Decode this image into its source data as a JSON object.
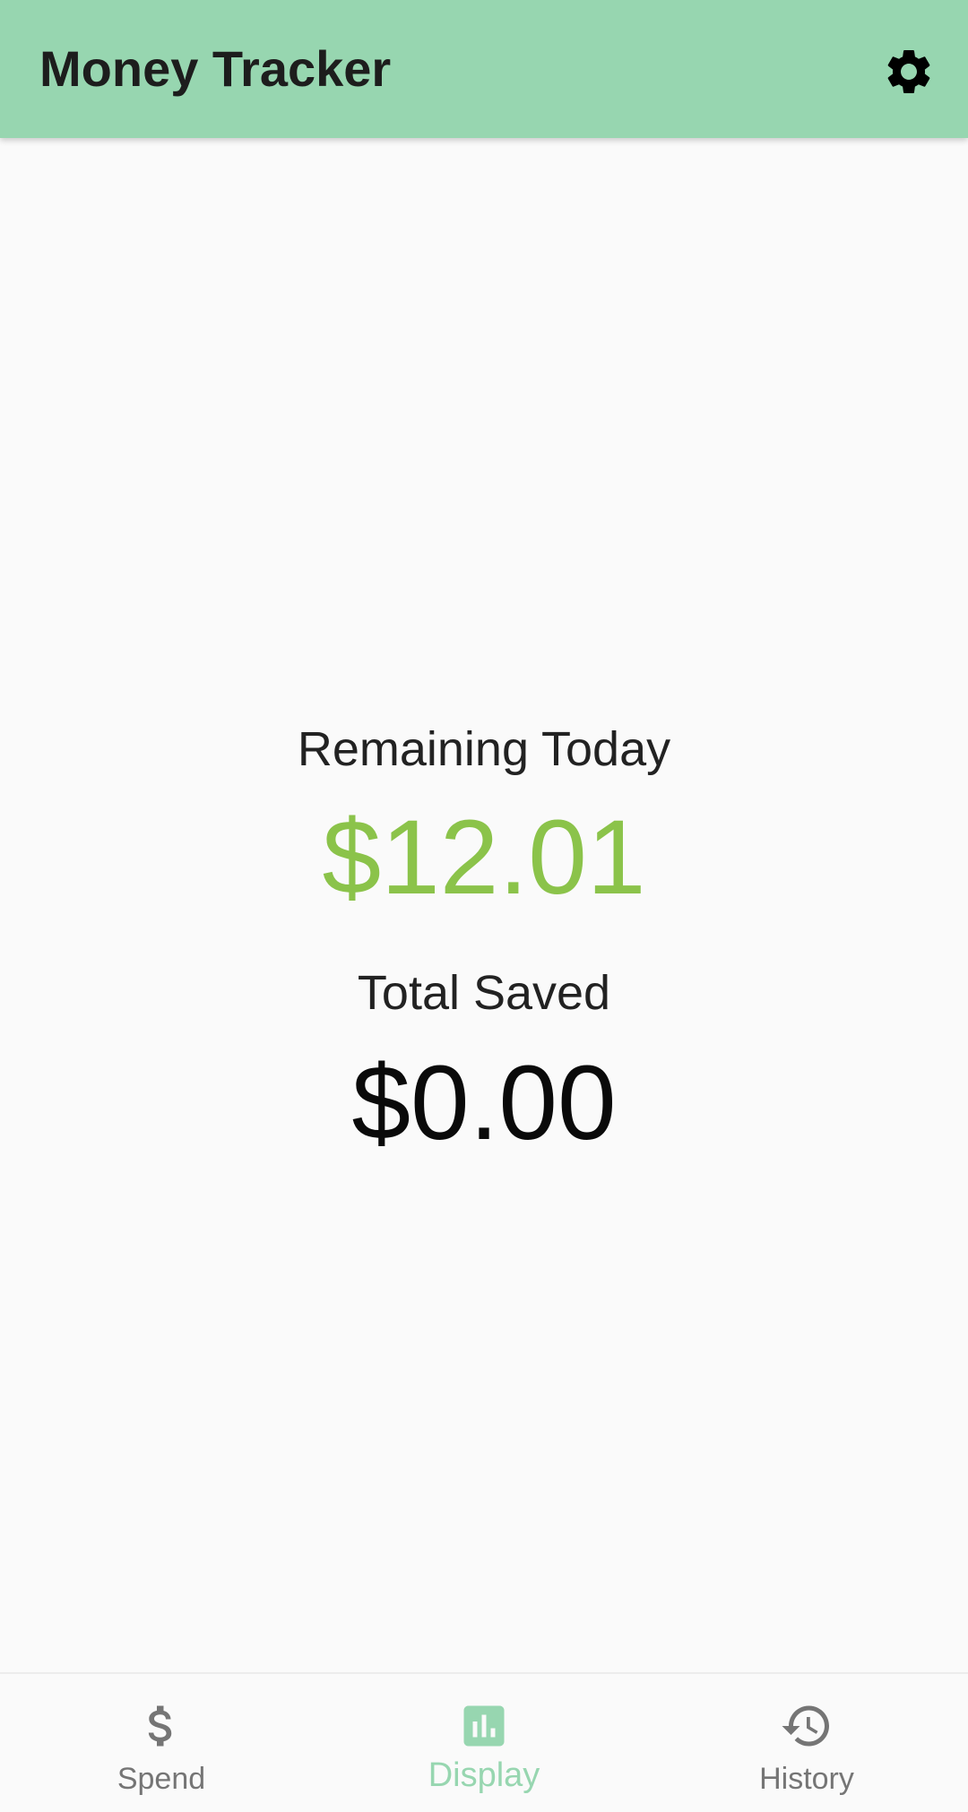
{
  "app_bar": {
    "title": "Money Tracker",
    "settings_icon": "gear-icon",
    "background_color": "#97d6b0"
  },
  "summary": {
    "remaining_label": "Remaining Today",
    "remaining_amount": "$12.01",
    "remaining_color": "#8bc34a",
    "saved_label": "Total Saved",
    "saved_amount": "$0.00"
  },
  "bottom_nav": {
    "active_color": "#97d6b0",
    "inactive_color": "#757575",
    "items": [
      {
        "label": "Spend",
        "icon": "dollar-icon",
        "active": false
      },
      {
        "label": "Display",
        "icon": "bar-chart-icon",
        "active": true
      },
      {
        "label": "History",
        "icon": "history-icon",
        "active": false
      }
    ]
  }
}
